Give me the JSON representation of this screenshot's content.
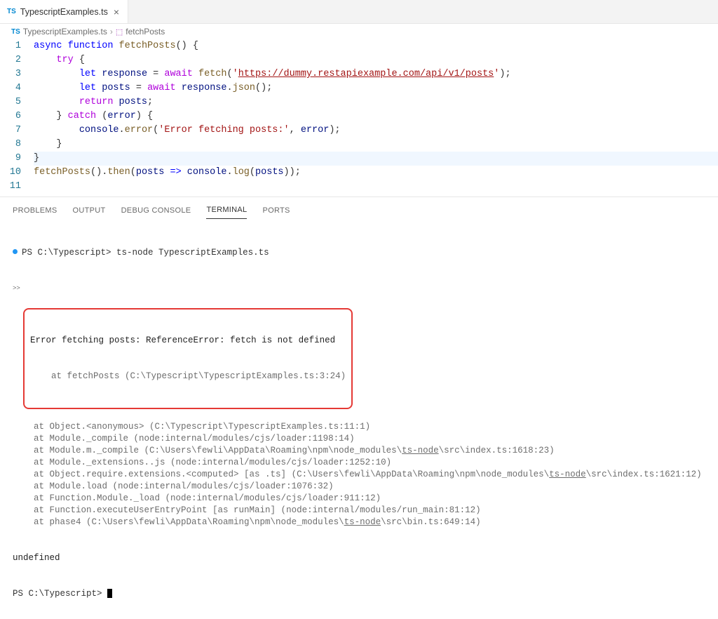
{
  "tab": {
    "filename": "TypescriptExamples.ts",
    "lang_badge": "TS"
  },
  "breadcrumb": {
    "lang_badge": "TS",
    "file": "TypescriptExamples.ts",
    "symbol": "fetchPosts"
  },
  "editor": {
    "lines": [
      {
        "n": 1,
        "tokens": [
          [
            "keyword",
            "async"
          ],
          [
            "plain",
            " "
          ],
          [
            "keyword",
            "function"
          ],
          [
            "plain",
            " "
          ],
          [
            "func",
            "fetchPosts"
          ],
          [
            "plain",
            "() {"
          ]
        ]
      },
      {
        "n": 2,
        "tokens": [
          [
            "plain",
            "    "
          ],
          [
            "control",
            "try"
          ],
          [
            "plain",
            " {"
          ]
        ]
      },
      {
        "n": 3,
        "tokens": [
          [
            "plain",
            "        "
          ],
          [
            "keyword",
            "let"
          ],
          [
            "plain",
            " "
          ],
          [
            "var",
            "response"
          ],
          [
            "plain",
            " = "
          ],
          [
            "control",
            "await"
          ],
          [
            "plain",
            " "
          ],
          [
            "func",
            "fetch"
          ],
          [
            "plain",
            "("
          ],
          [
            "string",
            "'"
          ],
          [
            "url",
            "https://dummy.restapiexample.com/api/v1/posts"
          ],
          [
            "string",
            "'"
          ],
          [
            "plain",
            ");"
          ]
        ]
      },
      {
        "n": 4,
        "tokens": [
          [
            "plain",
            "        "
          ],
          [
            "keyword",
            "let"
          ],
          [
            "plain",
            " "
          ],
          [
            "var",
            "posts"
          ],
          [
            "plain",
            " = "
          ],
          [
            "control",
            "await"
          ],
          [
            "plain",
            " "
          ],
          [
            "var",
            "response"
          ],
          [
            "plain",
            "."
          ],
          [
            "func",
            "json"
          ],
          [
            "plain",
            "();"
          ]
        ]
      },
      {
        "n": 5,
        "tokens": [
          [
            "plain",
            "        "
          ],
          [
            "control",
            "return"
          ],
          [
            "plain",
            " "
          ],
          [
            "var",
            "posts"
          ],
          [
            "plain",
            ";"
          ]
        ]
      },
      {
        "n": 6,
        "tokens": [
          [
            "plain",
            "    } "
          ],
          [
            "control",
            "catch"
          ],
          [
            "plain",
            " ("
          ],
          [
            "var",
            "error"
          ],
          [
            "plain",
            ") {"
          ]
        ]
      },
      {
        "n": 7,
        "tokens": [
          [
            "plain",
            "        "
          ],
          [
            "var",
            "console"
          ],
          [
            "plain",
            "."
          ],
          [
            "func",
            "error"
          ],
          [
            "plain",
            "("
          ],
          [
            "string",
            "'Error fetching posts:'"
          ],
          [
            "plain",
            ", "
          ],
          [
            "var",
            "error"
          ],
          [
            "plain",
            ");"
          ]
        ]
      },
      {
        "n": 8,
        "tokens": [
          [
            "plain",
            "    }"
          ]
        ]
      },
      {
        "n": 9,
        "tokens": [
          [
            "plain",
            "}"
          ]
        ],
        "active": true
      },
      {
        "n": 10,
        "tokens": [
          [
            "plain",
            ""
          ]
        ]
      },
      {
        "n": 11,
        "tokens": [
          [
            "func",
            "fetchPosts"
          ],
          [
            "plain",
            "()."
          ],
          [
            "func",
            "then"
          ],
          [
            "plain",
            "("
          ],
          [
            "var",
            "posts"
          ],
          [
            "plain",
            " "
          ],
          [
            "arrow",
            "=>"
          ],
          [
            "plain",
            " "
          ],
          [
            "var",
            "console"
          ],
          [
            "plain",
            "."
          ],
          [
            "func",
            "log"
          ],
          [
            "plain",
            "("
          ],
          [
            "var",
            "posts"
          ],
          [
            "plain",
            "));"
          ]
        ]
      }
    ]
  },
  "panel": {
    "tabs": [
      "PROBLEMS",
      "OUTPUT",
      "DEBUG CONSOLE",
      "TERMINAL",
      "PORTS"
    ],
    "active": "TERMINAL"
  },
  "terminal": {
    "prompt_path": "PS C:\\Typescript>",
    "command": "ts-node TypescriptExamples.ts",
    "raw_marker": ">>",
    "error_main": "Error fetching posts: ReferenceError: fetch is not defined",
    "error_at": "    at fetchPosts (C:\\Typescript\\TypescriptExamples.ts:3:24)",
    "stack": [
      {
        "pre": "    at Object.<anonymous> (C:\\Typescript\\TypescriptExamples.ts:11:1)",
        "u": []
      },
      {
        "pre": "    at Module._compile (node:internal/modules/cjs/loader:1198:14)",
        "u": []
      },
      {
        "pre": "    at Module.m._compile (C:\\Users\\fewli\\AppData\\Roaming\\npm\\node_modules\\",
        "u": "ts-node",
        "post": "\\src\\index.ts:1618:23)"
      },
      {
        "pre": "    at Module._extensions..js (node:internal/modules/cjs/loader:1252:10)",
        "u": []
      },
      {
        "pre": "    at Object.require.extensions.<computed> [as .ts] (C:\\Users\\fewli\\AppData\\Roaming\\npm\\node_modules\\",
        "u": "ts-node",
        "post": "\\src\\index.ts:1621:12)"
      },
      {
        "pre": "    at Module.load (node:internal/modules/cjs/loader:1076:32)",
        "u": []
      },
      {
        "pre": "    at Function.Module._load (node:internal/modules/cjs/loader:911:12)",
        "u": []
      },
      {
        "pre": "    at Function.executeUserEntryPoint [as runMain] (node:internal/modules/run_main:81:12)",
        "u": []
      },
      {
        "pre": "    at phase4 (C:\\Users\\fewli\\AppData\\Roaming\\npm\\node_modules\\",
        "u": "ts-node",
        "post": "\\src\\bin.ts:649:14)"
      }
    ],
    "undefined": "undefined",
    "prompt2": "PS C:\\Typescript>"
  }
}
